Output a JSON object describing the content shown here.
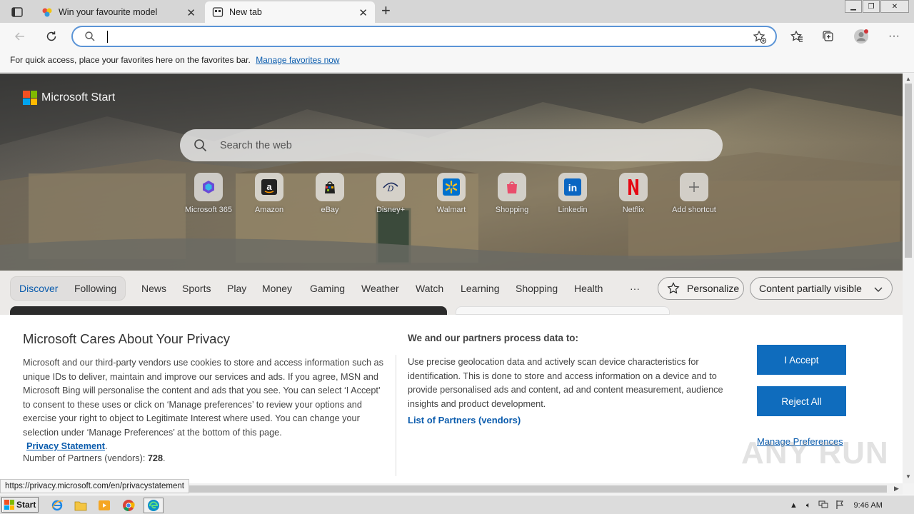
{
  "browser": {
    "tabs": [
      {
        "title": "Win your favourite model",
        "active": false
      },
      {
        "title": "New tab",
        "active": true
      }
    ],
    "address": {
      "value": "",
      "placeholder": ""
    },
    "favorites_bar": {
      "message": "For quick access, place your favorites here on the favorites bar.",
      "link": "Manage favorites now"
    }
  },
  "start_page": {
    "brand": "Microsoft Start",
    "search_placeholder": "Search the web",
    "shortcuts": [
      {
        "label": "Microsoft 365",
        "icon": "microsoft-365-icon"
      },
      {
        "label": "Amazon",
        "icon": "amazon-icon"
      },
      {
        "label": "eBay",
        "icon": "ebay-icon"
      },
      {
        "label": "Disney+",
        "icon": "disney-plus-icon"
      },
      {
        "label": "Walmart",
        "icon": "walmart-icon"
      },
      {
        "label": "Shopping",
        "icon": "shopping-bag-icon"
      },
      {
        "label": "Linkedin",
        "icon": "linkedin-icon"
      },
      {
        "label": "Netflix",
        "icon": "netflix-icon"
      },
      {
        "label": "Add shortcut",
        "icon": "plus-icon"
      }
    ],
    "nav": {
      "pills": [
        "Discover",
        "Following"
      ],
      "items": [
        "News",
        "Sports",
        "Play",
        "Money",
        "Gaming",
        "Weather",
        "Watch",
        "Learning",
        "Shopping",
        "Health"
      ],
      "more": "···",
      "personalize": "Personalize",
      "content_visibility": "Content partially visible"
    }
  },
  "privacy": {
    "title": "Microsoft Cares About Your Privacy",
    "body": "Microsoft and our third-party vendors use cookies to store and access information such as unique IDs to deliver, maintain and improve our services and ads. If you agree, MSN and Microsoft Bing will personalise the content and ads that you see. You can select ‘I Accept’ to consent to these uses or click on ‘Manage preferences’ to review your options and exercise your right to object to Legitimate Interest where used.  You can change your selection under ‘Manage Preferences’ at the bottom of this page.",
    "privacy_statement": "Privacy Statement",
    "partners_label": "Number of Partners (vendors): ",
    "partners_count": "728",
    "right_title": "We and our partners process data to:",
    "right_body": "Use precise geolocation data and actively scan device characteristics for identification. This is done to store and access information on a device and to provide personalised ads and content, ad and content measurement, audience insights and product development.",
    "vendors_link": "List of Partners (vendors)",
    "accept": "I Accept",
    "reject": "Reject All",
    "manage": "Manage Preferences"
  },
  "status_url": "https://privacy.microsoft.com/en/privacystatement",
  "watermark": "ANY RUN",
  "taskbar": {
    "start": "Start",
    "clock": "9:46 AM"
  },
  "colors": {
    "accent": "#0f6cbd",
    "link": "#0b5cad",
    "address_border": "#5b94d6"
  }
}
